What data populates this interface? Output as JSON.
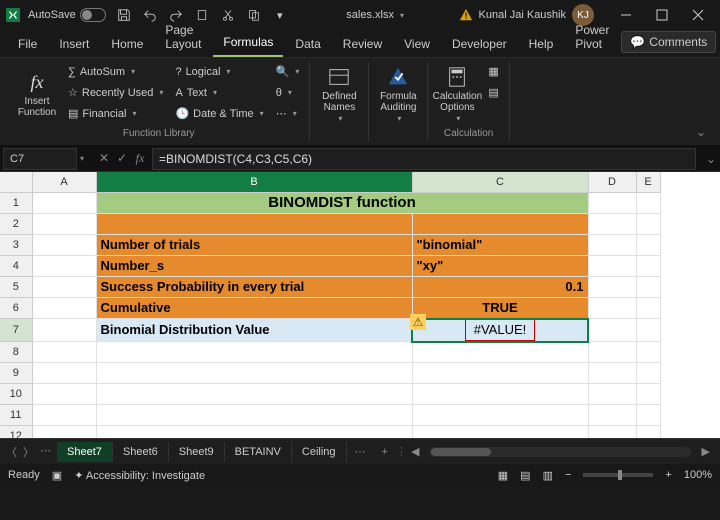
{
  "titlebar": {
    "autosave": "AutoSave",
    "filename": "sales.xlsx",
    "user": "Kunal Jai Kaushik",
    "initials": "KJ"
  },
  "tabs": [
    "File",
    "Insert",
    "Home",
    "Page Layout",
    "Formulas",
    "Data",
    "Review",
    "View",
    "Developer",
    "Help",
    "Power Pivot"
  ],
  "active_tab": "Formulas",
  "comments_btn": "Comments",
  "ribbon": {
    "insert_fn": "Insert\nFunction",
    "autosum": "AutoSum",
    "recent": "Recently Used",
    "financial": "Financial",
    "logical": "Logical",
    "text": "Text",
    "datetime": "Date & Time",
    "group1": "Function Library",
    "defined": "Defined\nNames",
    "auditing": "Formula\nAuditing",
    "calc_opt": "Calculation\nOptions",
    "group_calc": "Calculation"
  },
  "namebox": "C7",
  "formula": "=BINOMDIST(C4,C3,C5,C6)",
  "cols": [
    "A",
    "B",
    "C",
    "D",
    "E"
  ],
  "rows": [
    "1",
    "2",
    "3",
    "4",
    "5",
    "6",
    "7",
    "8",
    "9",
    "10",
    "11",
    "12"
  ],
  "sheet": {
    "title": "BINOMDIST function",
    "r3b": "Number of trials",
    "r3c": "\"binomial\"",
    "r4b": "Number_s",
    "r4c": "\"xy\"",
    "r5b": "Success Probability in every trial",
    "r5c": "0.1",
    "r6b": "Cumulative",
    "r6c": "TRUE",
    "r7b": "Binomial Distribution Value",
    "r7c": "#VALUE!"
  },
  "sheet_tabs": [
    "Sheet7",
    "Sheet6",
    "Sheet9",
    "BETAINV",
    "Ceiling"
  ],
  "status": {
    "ready": "Ready",
    "acc": "Accessibility: Investigate",
    "zoom": "100%"
  },
  "chart_data": {
    "type": "table",
    "title": "BINOMDIST function",
    "rows": [
      [
        "Number of trials",
        "\"binomial\""
      ],
      [
        "Number_s",
        "\"xy\""
      ],
      [
        "Success Probability in every trial",
        0.1
      ],
      [
        "Cumulative",
        "TRUE"
      ],
      [
        "Binomial Distribution Value",
        "#VALUE!"
      ]
    ]
  }
}
